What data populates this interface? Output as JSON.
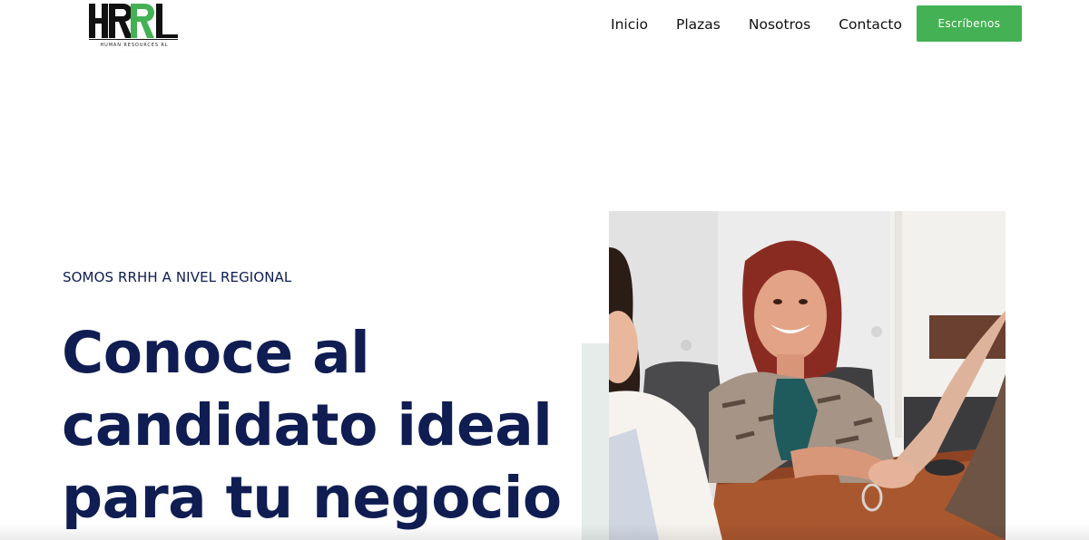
{
  "brand": {
    "logo_text": "HRRL",
    "logo_subtitle": "HUMAN RESOURCES RL",
    "logo_accent_color": "#44b254"
  },
  "nav": {
    "items": [
      {
        "label": "Inicio"
      },
      {
        "label": "Plazas"
      },
      {
        "label": "Nosotros"
      },
      {
        "label": "Contacto"
      }
    ]
  },
  "cta": {
    "label": "Escríbenos",
    "color": "#44b254"
  },
  "hero": {
    "eyebrow": "SOMOS RRHH A NIVEL REGIONAL",
    "headline_lines": [
      "Conoce al",
      "candidato ideal",
      "para tu negocio"
    ],
    "text_color": "#0f1d52",
    "image_description_icon": "handshake-photo"
  }
}
